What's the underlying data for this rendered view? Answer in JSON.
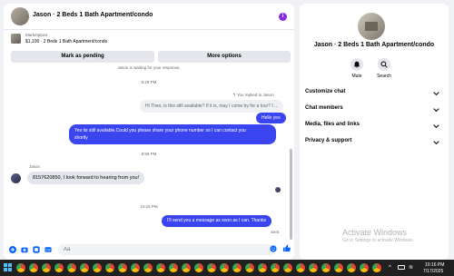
{
  "chat": {
    "title": "Jason · 2 Beds 1 Bath Apartment/condo",
    "marketplace_label": "Marketplace",
    "marketplace_item": "$1,100 · 2 Beds 1 Bath Apartment/condo",
    "mark_pending_label": "Mark as pending",
    "more_options_label": "More options"
  },
  "messages": {
    "waiting_note": "Jason is waiting for your response.",
    "time1": "8:25 PM",
    "replied_note": "You replied to Jason",
    "quoted_text": "Hi Theo, is this still available? If it is, may I come by for a tour? I ...",
    "out1": "Hello yes",
    "out2_line1": "Yes its still available.Could you please share your phone number so I can contact you",
    "out2_line2": "shortly",
    "time2": "8:59 PM",
    "sender": "Jason",
    "in1": "8157620850, I look forward to hearing from you!",
    "time3": "10:16 PM",
    "out3": "I'll send you a message as soon as I can. Thanks",
    "status": "Sent"
  },
  "composer": {
    "placeholder": "Aa"
  },
  "info": {
    "title": "Jason · 2 Beds 1 Bath Apartment/condo",
    "mute_label": "Mute",
    "search_label": "Search",
    "sections": [
      "Customize chat",
      "Chat members",
      "Media, files and links",
      "Privacy & support"
    ]
  },
  "watermark": {
    "title": "Activate Windows",
    "subtitle": "Go to Settings to activate Windows."
  },
  "taskbar": {
    "time": "10:16 PM",
    "date": "7/17/2025"
  },
  "colors": {
    "accent": "#3a45f0",
    "info_icon": "#8a2be2"
  }
}
